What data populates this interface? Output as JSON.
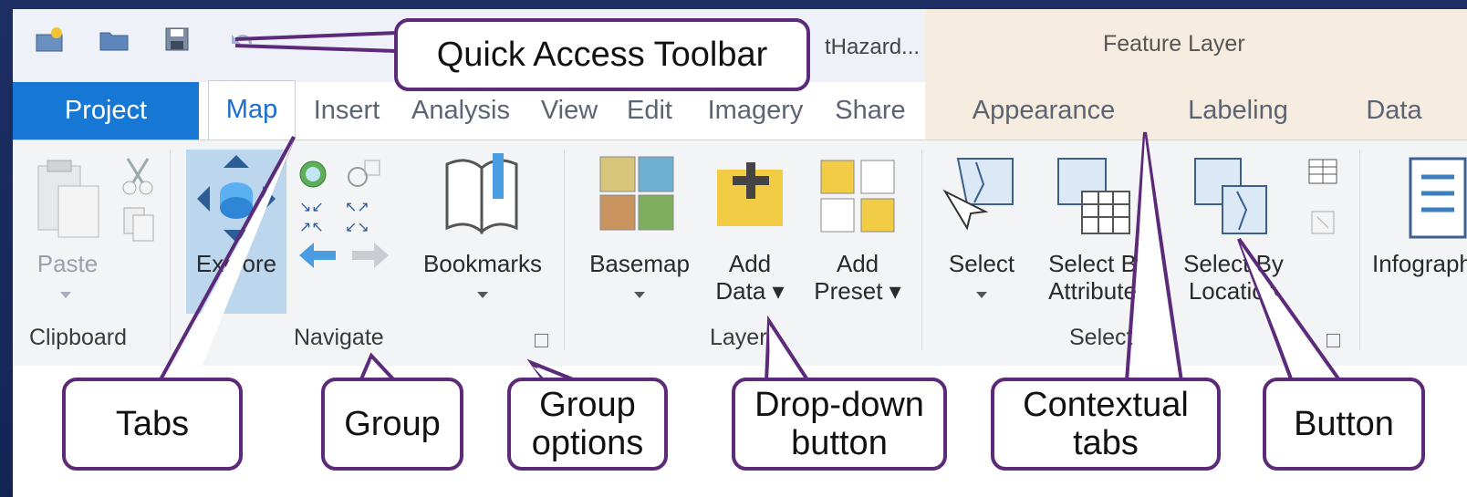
{
  "title_bar": {
    "doc_title": "tHazard...",
    "contextual_title": "Feature Layer",
    "qat_icons": [
      "new-project-icon",
      "open-folder-icon",
      "save-icon",
      "undo-icon"
    ]
  },
  "tabs": [
    "Project",
    "Map",
    "Insert",
    "Analysis",
    "View",
    "Edit",
    "Imagery",
    "Share"
  ],
  "contextual_tabs": [
    "Appearance",
    "Labeling",
    "Data"
  ],
  "ribbon": {
    "clipboard": {
      "paste": "Paste",
      "group": "Clipboard"
    },
    "navigate": {
      "explore": "Explore",
      "bookmarks": "Bookmarks",
      "group": "Navigate"
    },
    "layer": {
      "basemap": "Basemap",
      "add_data_1": "Add",
      "add_data_2": "Data",
      "add_preset_1": "Add",
      "add_preset_2": "Preset",
      "group": "Layer"
    },
    "selection": {
      "select": "Select",
      "by_attr_1": "Select By",
      "by_attr_2": "Attributes",
      "by_loc_1": "Select By",
      "by_loc_2": "Location",
      "group": "Selection"
    },
    "infographics": "Infographics"
  },
  "callouts": {
    "qat": "Quick Access Toolbar",
    "tabs": "Tabs",
    "group": "Group",
    "group_options_1": "Group",
    "group_options_2": "options",
    "dropdown_1": "Drop-down",
    "dropdown_2": "button",
    "contextual_1": "Contextual",
    "contextual_2": "tabs",
    "button": "Button"
  },
  "colors": {
    "accent_purple": "#5b2a78",
    "project_tab": "#1777d4",
    "active_tab_text": "#1a6fcf",
    "contextual_band": "#f7ece0",
    "background": "#1d2e63"
  }
}
